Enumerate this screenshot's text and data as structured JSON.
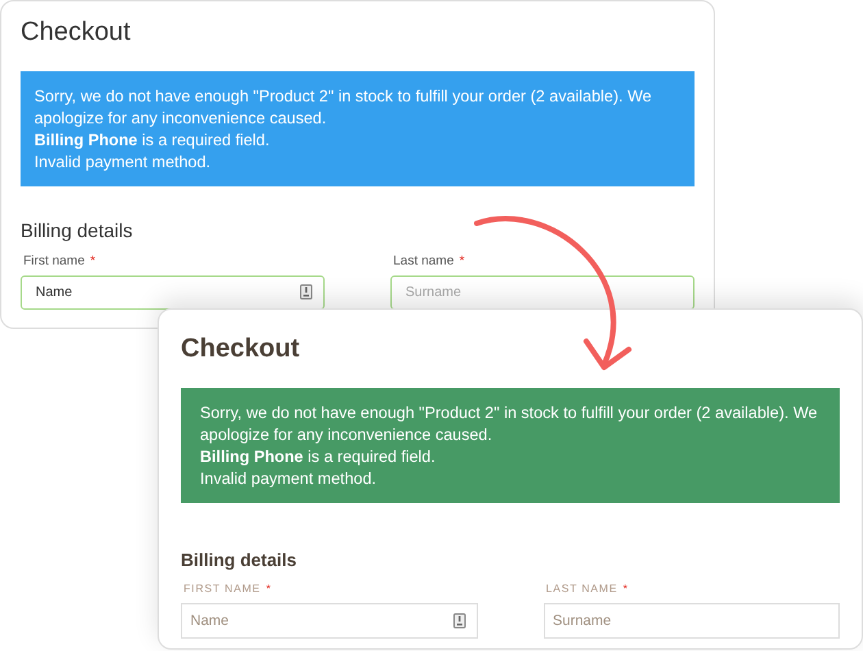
{
  "panels": [
    {
      "kind": "before",
      "title": "Checkout",
      "notice": [
        "Sorry, we do not have enough \"Product 2\" in stock to fulfill your order (2 available). We apologize for any inconvenience caused.",
        "**Billing Phone** is a required field.",
        "Invalid payment method."
      ],
      "section_title": "Billing details",
      "fields": [
        {
          "kind": "autofill",
          "label": "First name",
          "required_mark": "*",
          "value": "Name"
        },
        {
          "kind": "plain",
          "label": "Last name",
          "required_mark": "*",
          "placeholder": "Surname"
        }
      ]
    },
    {
      "kind": "after",
      "title": "Checkout",
      "notice": [
        "Sorry, we do not have enough \"Product 2\" in stock to fulfill your order (2 available). We apologize for any inconvenience caused.",
        "**Billing Phone** is a required field.",
        "Invalid payment method."
      ],
      "section_title": "Billing details",
      "fields": [
        {
          "kind": "autofill",
          "label": "FIRST NAME",
          "required_mark": "*",
          "placeholder": "Name"
        },
        {
          "kind": "plain",
          "label": "LAST NAME",
          "required_mark": "*",
          "placeholder": "Surname"
        }
      ]
    }
  ]
}
